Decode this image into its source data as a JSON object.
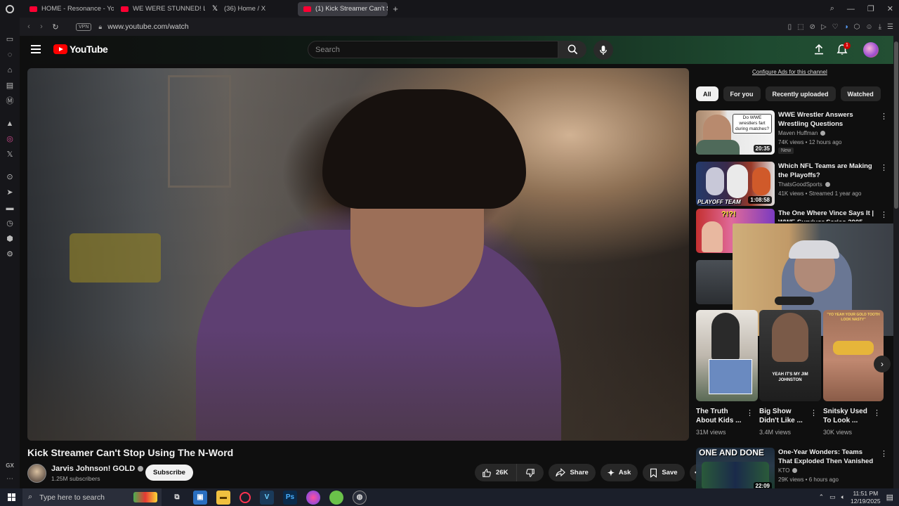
{
  "browser": {
    "tabs": [
      {
        "title": "HOME - Resonance - You",
        "favicon_color": "#ff0033",
        "active": false
      },
      {
        "title": "WE WERE STUNNED! Lo",
        "favicon_color": "#ff0033",
        "active": false
      },
      {
        "title": "(36) Home / X",
        "favicon_color": "#ffffff",
        "active": false
      },
      {
        "title": "(1) Kick Streamer Can't St",
        "favicon_color": "#ff0033",
        "active": true
      }
    ],
    "new_tab_label": "+",
    "url": "www.youtube.com/watch",
    "vpn_label": "VPN",
    "sidebar_bottom_label": "GX"
  },
  "youtube": {
    "logo_text": "YouTube",
    "search_placeholder": "Search",
    "notification_count": "1",
    "video": {
      "title": "Kick Streamer Can't Stop Using The N-Word",
      "channel": "Jarvis Johnson! GOLD",
      "subscribers": "1.25M subscribers",
      "subscribe_label": "Subscribe",
      "likes": "26K",
      "share_label": "Share",
      "ask_label": "Ask",
      "save_label": "Save"
    },
    "configure_ads": "Configure Ads for this channel",
    "chips": [
      "All",
      "For you",
      "Recently uploaded",
      "Watched"
    ],
    "recommendations": [
      {
        "title": "WWE Wrestler Answers Wrestling Questions",
        "channel": "Maven Huffman",
        "meta": "74K views • 12 hours ago",
        "duration": "20:35",
        "badge": "New",
        "thumb_text": "Do WWE wrestlers fart during matches?"
      },
      {
        "title": "Which NFL Teams are Making the Playoffs?",
        "channel": "ThatsGoodSports",
        "meta": "41K views • Streamed 1 year ago",
        "duration": "1:08:58",
        "thumb_text": "PLAYOFF TEAM"
      },
      {
        "title": "The One Where Vince Says It | WWE Survivor Series 2005",
        "thumb_text": "?!?!"
      }
    ],
    "shorts": [
      {
        "title": "The Truth About Kids ...",
        "views": "31M views"
      },
      {
        "title": "Big Show Didn't Like ...",
        "views": "3.4M views",
        "thumb_text": "YEAH IT'S MY JIM JOHNSTON"
      },
      {
        "title": "Snitsky Used To Look ...",
        "views": "30K views",
        "thumb_text": "\"YO YEAH YOUR GOLD TOOTH LOOK NASTY\""
      }
    ],
    "bottom_rec": {
      "title": "One-Year Wonders: Teams That Exploded Then Vanished",
      "channel": "KTO",
      "meta": "29K views • 6 hours ago",
      "duration": "22:09",
      "thumb_text": "ONE AND DONE"
    }
  },
  "taskbar": {
    "search_placeholder": "Type here to search",
    "time": "11:51 PM",
    "date": "12/19/2025"
  }
}
